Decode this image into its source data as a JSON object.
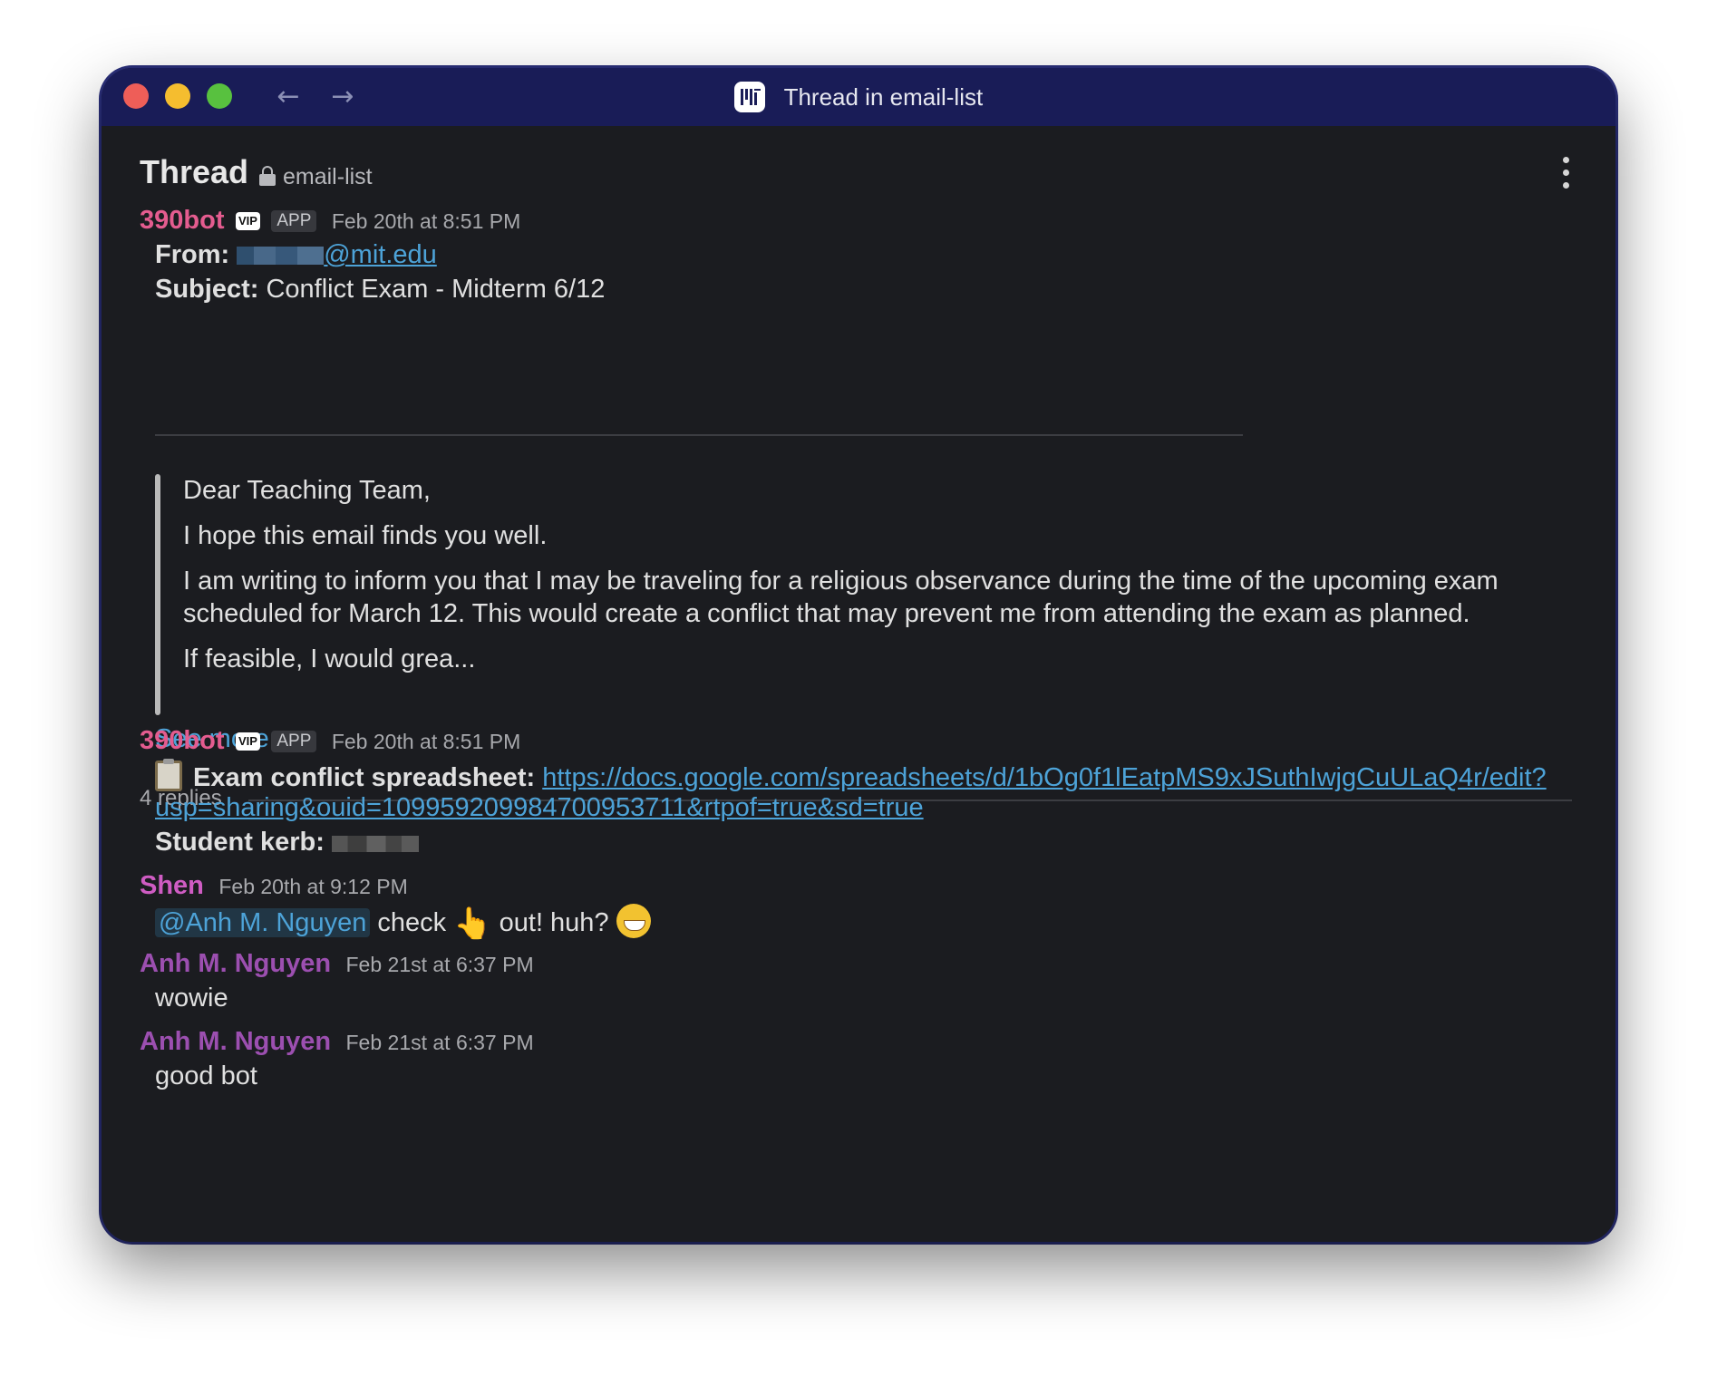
{
  "window": {
    "title": "Thread in email-list",
    "nav": {
      "back_icon": "←",
      "forward_icon": "→"
    }
  },
  "header": {
    "title": "Thread",
    "channel": "email-list"
  },
  "root_message": {
    "author": "390bot",
    "vip_badge": "VIP",
    "app_badge": "APP",
    "timestamp": "Feb 20th at 8:51 PM",
    "from_label": "From:",
    "from_email": "@mit.edu",
    "subject_label": "Subject:",
    "subject": "Conflict Exam - Midterm 6/12",
    "body": [
      "Dear Teaching Team,",
      "I hope this email finds you well.",
      "I am writing to inform you that I may be traveling for a religious observance during the time of the upcoming exam",
      "scheduled for March 12. This would create a conflict that may prevent me from attending the exam as planned.",
      "If feasible, I would grea..."
    ],
    "see_more": "See more"
  },
  "replies_count": "4 replies",
  "replies": [
    {
      "author": "390bot",
      "vip_badge": "VIP",
      "app_badge": "APP",
      "timestamp": "Feb 20th at 8:51 PM",
      "spreadsheet_label": "Exam conflict spreadsheet:",
      "spreadsheet_url_line1": "https://docs.google.com/spreadsheets/d/1bOg0f1lEatpMS9xJSuthIwjgCuULaQ4r/edit?",
      "spreadsheet_url_line2": "usp=sharing&ouid=109959209984700953711&rtpof=true&sd=true",
      "kerb_label": "Student kerb:"
    },
    {
      "author": "Shen",
      "timestamp": "Feb 20th at 9:12 PM",
      "mention": "@Anh M. Nguyen",
      "text_a": "check",
      "text_b": "out! huh?",
      "emoji_point": "👆",
      "emoji_grin": "grinning-face-icon"
    },
    {
      "author": "Anh M. Nguyen",
      "timestamp": "Feb 21st at 6:37 PM",
      "text": "wowie"
    },
    {
      "author": "Anh M. Nguyen",
      "timestamp": "Feb 21st at 6:37 PM",
      "text": "good bot"
    }
  ],
  "colors": {
    "titlebar": "#191c57",
    "background": "#1b1c20",
    "bot_name": "#e45c8f",
    "shen_name": "#cf5cc3",
    "anh_name": "#9c4fb0",
    "link": "#4da3d8"
  }
}
